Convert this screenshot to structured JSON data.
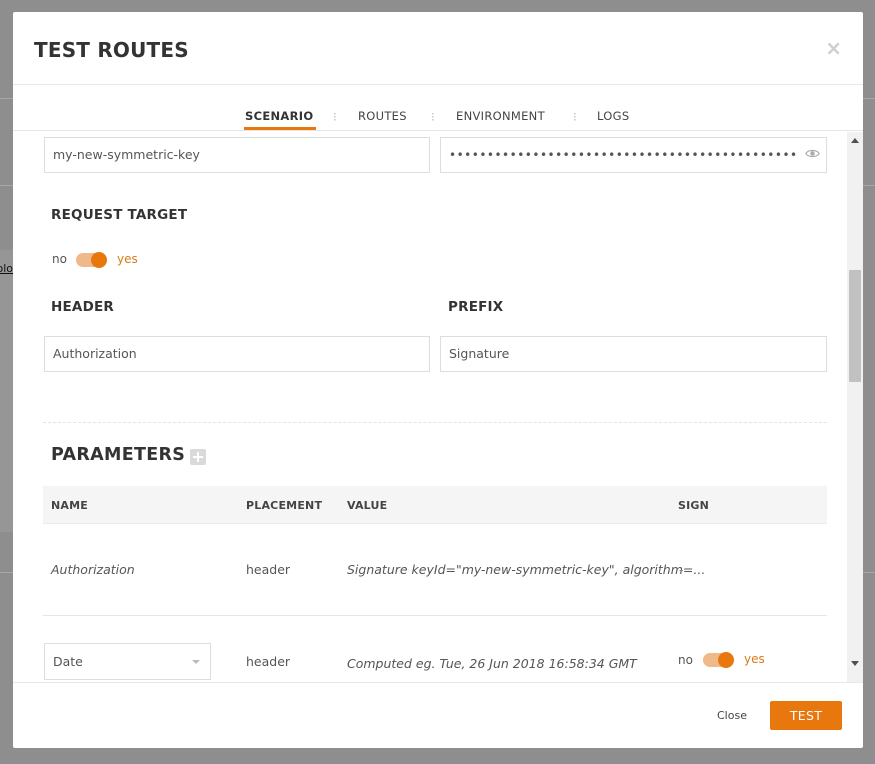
{
  "background": {
    "link_fragment": "olo"
  },
  "modal": {
    "title": "TEST ROUTES",
    "close_icon": "×"
  },
  "tabs": [
    {
      "label": "SCENARIO",
      "active": true
    },
    {
      "label": "ROUTES",
      "active": false
    },
    {
      "label": "ENVIRONMENT",
      "active": false
    },
    {
      "label": "LOGS",
      "active": false
    }
  ],
  "tab_separator": "⁝",
  "credentials": {
    "key_id": "my-new-symmetric-key",
    "secret_masked": "••••••••••••••••••••••••••••••••••••••••••••••"
  },
  "request_target": {
    "label": "REQUEST TARGET",
    "no": "no",
    "yes": "yes",
    "enabled": true
  },
  "header_section": {
    "header_label": "HEADER",
    "header_value": "Authorization",
    "prefix_label": "PREFIX",
    "prefix_value": "Signature"
  },
  "parameters": {
    "title": "PARAMETERS",
    "columns": [
      "NAME",
      "PLACEMENT",
      "VALUE",
      "SIGN"
    ],
    "rows": [
      {
        "name": "Authorization",
        "placement": "header",
        "value": "Signature keyId=\"my-new-symmetric-key\", algorithm=...",
        "sign": "-"
      },
      {
        "name": "Date",
        "placement": "header",
        "value": "Computed eg. Tue, 26 Jun 2018 16:58:34 GMT",
        "sign_no": "no",
        "sign_yes": "yes",
        "sign_enabled": true
      }
    ]
  },
  "footer": {
    "close_label": "Close",
    "test_label": "TEST"
  },
  "colors": {
    "accent": "#e8770e",
    "toggle_track": "#f0b989"
  }
}
